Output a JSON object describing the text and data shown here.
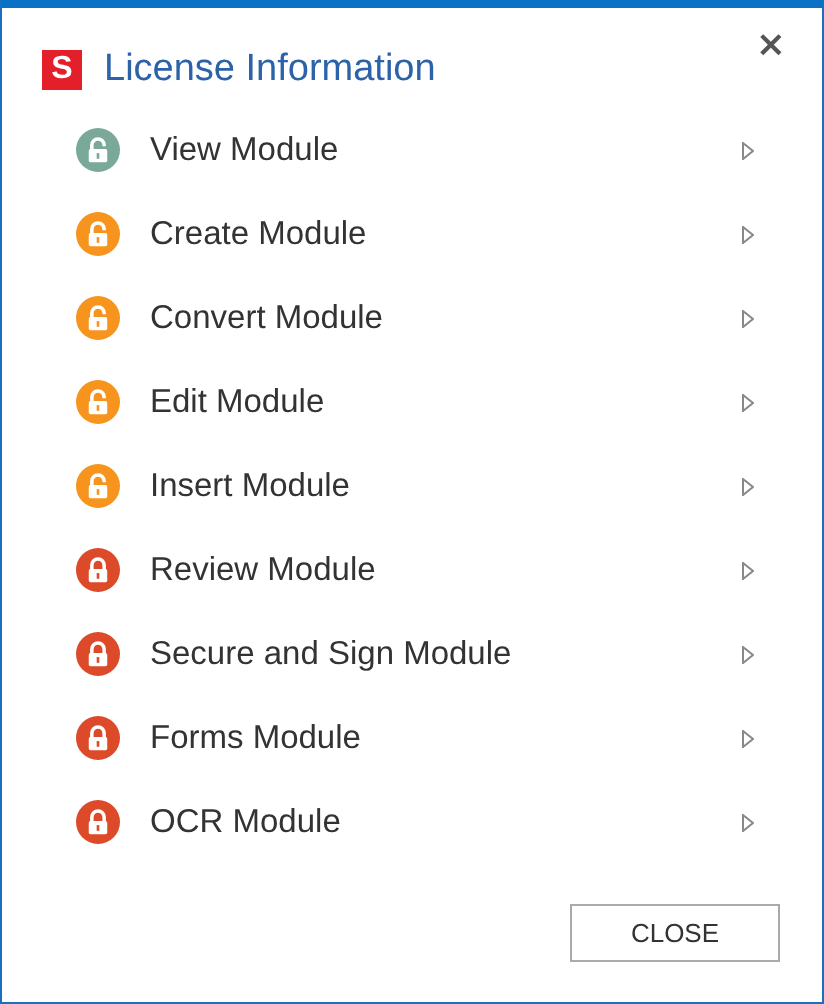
{
  "window": {
    "title": "License Information",
    "logo": "S",
    "close_glyph": "×"
  },
  "modules": [
    {
      "label": "View Module",
      "locked": false,
      "color": "#7aa99a"
    },
    {
      "label": "Create Module",
      "locked": false,
      "color": "#f7941d"
    },
    {
      "label": "Convert Module",
      "locked": false,
      "color": "#f7941d"
    },
    {
      "label": "Edit Module",
      "locked": false,
      "color": "#f7941d"
    },
    {
      "label": "Insert Module",
      "locked": false,
      "color": "#f7941d"
    },
    {
      "label": "Review Module",
      "locked": true,
      "color": "#dd4a2a"
    },
    {
      "label": "Secure and Sign Module",
      "locked": true,
      "color": "#dd4a2a"
    },
    {
      "label": "Forms Module",
      "locked": true,
      "color": "#dd4a2a"
    },
    {
      "label": "OCR Module",
      "locked": true,
      "color": "#dd4a2a"
    }
  ],
  "buttons": [
    "CLOSE"
  ]
}
